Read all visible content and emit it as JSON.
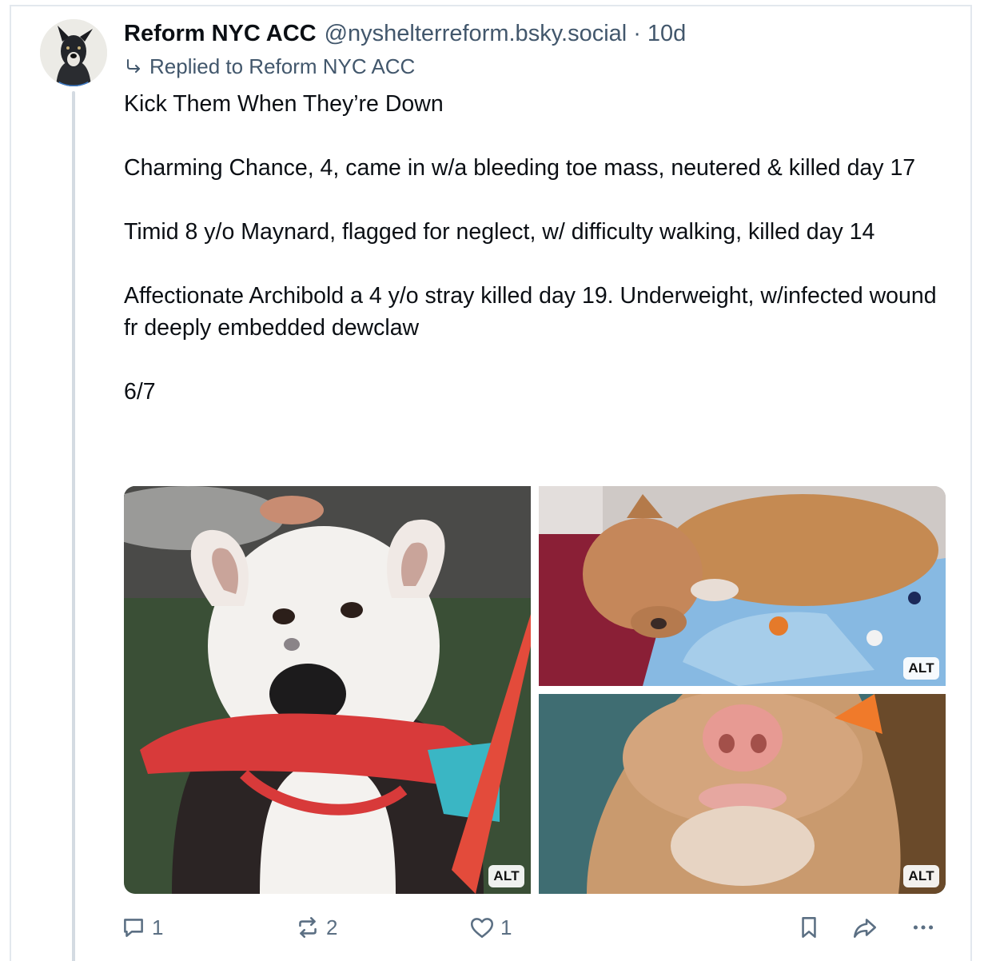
{
  "post": {
    "author_name": "Reform NYC ACC",
    "author_handle": "@nyshelterreform.bsky.social",
    "separator": "·",
    "age": "10d",
    "reply_to": "Replied to Reform NYC ACC",
    "paragraphs": [
      "Kick Them When They’re Down",
      "Charming Chance, 4, came in w/a bleeding toe mass, neutered & killed day 17",
      "Timid 8 y/o Maynard, flagged for neglect, w/ difficulty walking, killed day 14",
      "Affectionate Archibold a 4 y/o stray killed day 19. Underweight, w/infected wound fr deeply embedded dewclaw",
      "6/7"
    ],
    "images": [
      {
        "alt_badge": "ALT"
      },
      {
        "alt_badge": "ALT"
      },
      {
        "alt_badge": "ALT"
      }
    ],
    "actions": {
      "reply_count": "1",
      "repost_count": "2",
      "like_count": "1"
    }
  },
  "icons": {
    "reply": "reply-bubble-icon",
    "repost": "repost-arrows-icon",
    "like": "heart-icon",
    "bookmark": "bookmark-icon",
    "share": "share-arrow-icon",
    "more": "more-dots-icon",
    "reply_to": "reply-arrow-icon"
  },
  "colors": {
    "text": "#0b0f14",
    "muted": "#42576c",
    "icon": "#5b6f83",
    "thread_line": "#d4dbe2"
  }
}
